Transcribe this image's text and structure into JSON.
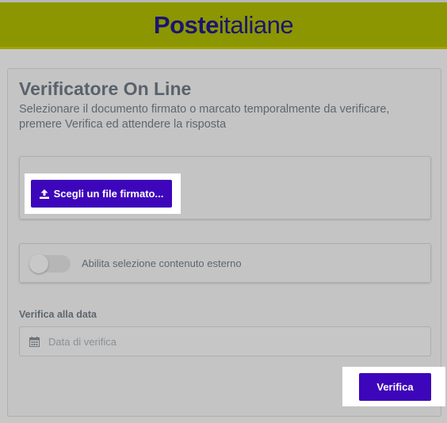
{
  "header": {
    "logo_bold": "Poste",
    "logo_light": "italiane"
  },
  "main": {
    "title": "Verificatore On Line",
    "description": "Selezionare il documento firmato o marcato temporalmente da verificare, premere Verifica ed attendere la risposta",
    "file_button_label": "Scegli un file firmato...",
    "file_button_icon": "upload-icon",
    "toggle": {
      "label": "Abilita selezione contenuto esterno",
      "state": "off"
    },
    "date": {
      "label": "Verifica alla data",
      "placeholder": "Data di verifica",
      "value": "",
      "icon": "calendar-icon"
    },
    "verify_button_label": "Verifica"
  },
  "colors": {
    "header_bg": "#8c9600",
    "brand_text": "#1a1470",
    "button_bg": "#3d06ba",
    "button_text": "#ffffff",
    "page_bg": "#c7c7c7"
  }
}
